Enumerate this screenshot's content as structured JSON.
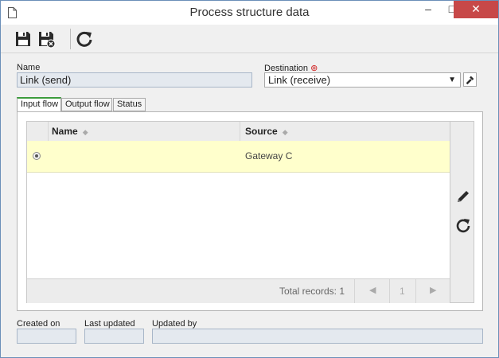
{
  "window": {
    "title": "Process structure data",
    "minimize_glyph": "–",
    "maximize_glyph": "□",
    "close_glyph": "✕"
  },
  "toolbar": {
    "items": [
      "save-icon",
      "save-and-close-icon",
      "refresh-icon"
    ]
  },
  "form": {
    "name_label": "Name",
    "name_value": "Link (send)",
    "destination_label": "Destination",
    "destination_required_glyph": "⊕",
    "destination_value": "Link (receive)",
    "dropdown_glyph": "▼"
  },
  "tabs": [
    {
      "label": "Input flow",
      "active": true
    },
    {
      "label": "Output flow",
      "active": false
    },
    {
      "label": "Status",
      "active": false
    }
  ],
  "grid": {
    "columns": [
      "Name",
      "Source"
    ],
    "sort_glyph": "◆",
    "rows": [
      {
        "name": "",
        "source": "Gateway C",
        "selected": true
      }
    ],
    "total_records": "Total records: 1",
    "pager": {
      "prev": "◀",
      "page": "1",
      "next": "▶"
    }
  },
  "side_actions": [
    "edit-icon",
    "refresh-icon"
  ],
  "footer": {
    "created_on_label": "Created on",
    "created_on_value": "",
    "last_updated_label": "Last updated",
    "last_updated_value": "",
    "updated_by_label": "Updated by",
    "updated_by_value": ""
  },
  "colors": {
    "active_tab_accent": "#3c9b3c",
    "selected_row": "#ffffcc",
    "close_button": "#c74848",
    "required_marker": "#d02020"
  }
}
